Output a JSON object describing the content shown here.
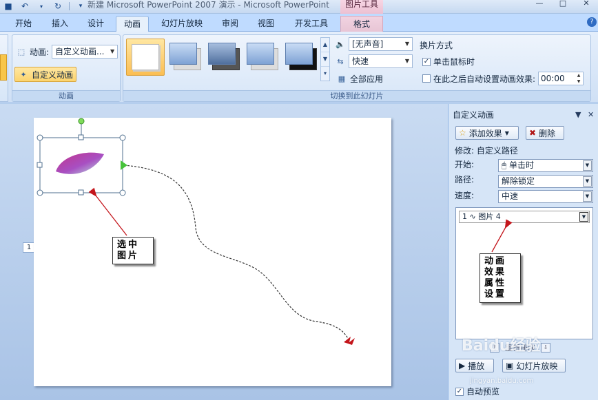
{
  "window": {
    "title": "新建 Microsoft PowerPoint 2007 演示 - Microsoft PowerPoint",
    "context_tab_title": "图片工具"
  },
  "tabs": [
    {
      "label": "开始"
    },
    {
      "label": "插入"
    },
    {
      "label": "设计"
    },
    {
      "label": "动画",
      "active": true
    },
    {
      "label": "幻灯片放映"
    },
    {
      "label": "审阅"
    },
    {
      "label": "视图"
    },
    {
      "label": "开发工具"
    },
    {
      "label": "格式",
      "contextual": true
    }
  ],
  "ribbon": {
    "animation_group": {
      "animate_label": "动画:",
      "animate_value": "自定义动画...",
      "custom_animation_button": "自定义动画",
      "group_label": "动画"
    },
    "transition_group": {
      "sound_value": "[无声音]",
      "speed_value": "快速",
      "apply_all": "全部应用",
      "advance_title": "换片方式",
      "on_click_label": "单击鼠标时",
      "on_click_checked": true,
      "after_label": "在此之后自动设置动画效果:",
      "after_checked": false,
      "after_value": "00:00",
      "group_label": "切换到此幻灯片"
    }
  },
  "slide": {
    "number": "1",
    "callout_selected": "选中图片",
    "callout_props": "动画效果属性设置"
  },
  "task_pane": {
    "title": "自定义动画",
    "add_effect": "添加效果",
    "remove": "删除",
    "modify_label": "修改: 自定义路径",
    "start_label": "开始:",
    "start_value": "单击时",
    "path_label": "路径:",
    "path_value": "解除锁定",
    "speed_label": "速度:",
    "speed_value": "中速",
    "list_item": "1  ∿ 图片 4",
    "reorder_label": "重新排序",
    "play_button": "播放",
    "slideshow_button": "幻灯片放映",
    "autopreview_label": "自动预览",
    "autopreview_checked": true
  },
  "watermark": {
    "text": "Baidu经验",
    "url": "jingyan.baidu.com"
  }
}
